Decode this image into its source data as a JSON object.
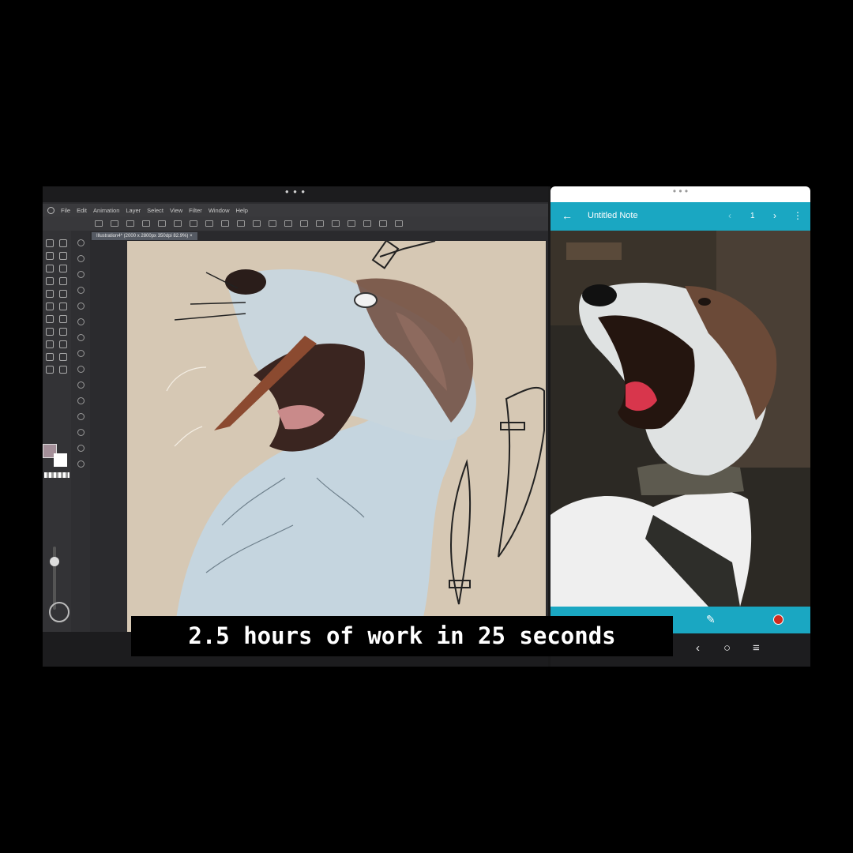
{
  "drawing_app": {
    "handle": "• • •",
    "menu": [
      "File",
      "Edit",
      "Animation",
      "Layer",
      "Select",
      "View",
      "Filter",
      "Window",
      "Help"
    ],
    "tab": "Illustration4* (2000 x 2800px 350dpi 82.9%)",
    "tab_close": "×",
    "foreground_color": "#a48f99",
    "background_color": "#ffffff"
  },
  "notes_app": {
    "handle": "• • •",
    "back_icon": "←",
    "title": "Untitled Note",
    "prev_icon": "‹",
    "page_number": "1",
    "next_icon": "›",
    "more_icon": "⋮",
    "pencil_icon": "✎",
    "accent_color": "#1aa7c2",
    "record_color": "#d02b1e"
  },
  "system_nav": {
    "back": "‹",
    "home": "○",
    "recents": "≡"
  },
  "caption": "2.5 hours of work in 25 seconds"
}
